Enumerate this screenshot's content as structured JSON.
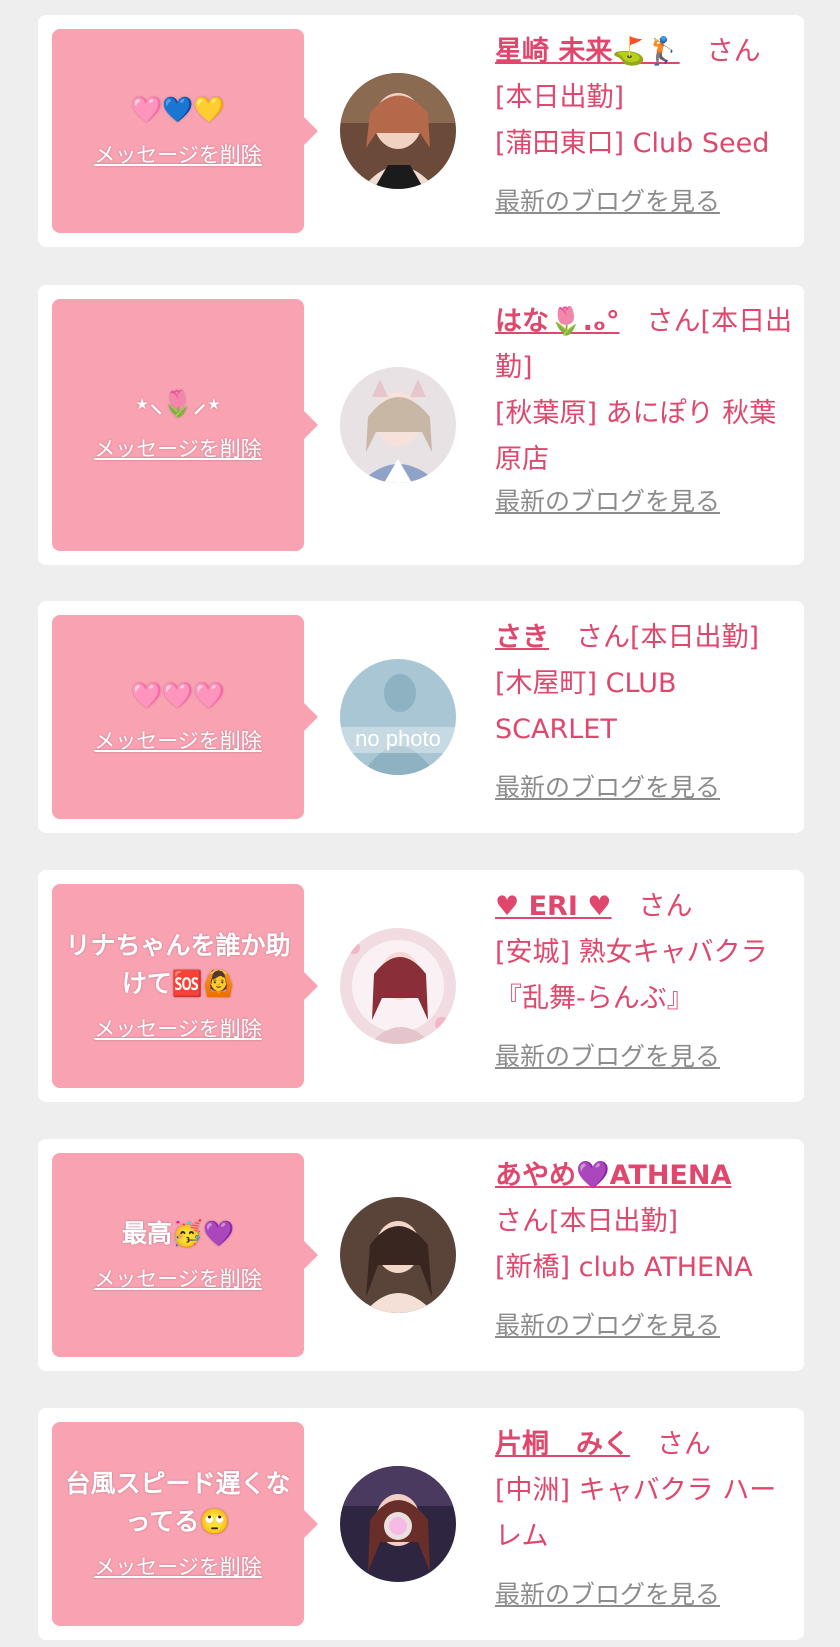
{
  "cards": [
    {
      "message": "🩷💙💛",
      "delete_label": "メッセージを削除",
      "name": "星崎 未来⛳️🏌️",
      "suffix": "　さん",
      "lines": [
        "[本日出勤]",
        "[蒲田東口] Club Seed"
      ],
      "blog_label": "最新のブログを見る",
      "avatar": "photo"
    },
    {
      "message": "⋆⸜🌷⸝⋆",
      "delete_label": "メッセージを削除",
      "name": "はな🌷.ₒ°",
      "suffix": "　さん[本日出勤]",
      "lines": [
        "[秋葉原] あにぽり 秋葉原店"
      ],
      "blog_label": "最新のブログを見る",
      "avatar": "photo"
    },
    {
      "message": "🩷🩷🩷",
      "delete_label": "メッセージを削除",
      "name": "さき",
      "suffix": "　さん[本日出勤]",
      "lines": [
        "[木屋町] CLUB SCARLET"
      ],
      "blog_label": "最新のブログを見る",
      "avatar": "no photo"
    },
    {
      "message": "リナちゃんを誰か助けて🆘🙆",
      "delete_label": "メッセージを削除",
      "name": "♥︎ ERI ♥︎",
      "suffix": "　さん",
      "lines": [
        "[安城] 熟女キャバクラ『乱舞-らんぶ』"
      ],
      "blog_label": "最新のブログを見る",
      "avatar": "photo"
    },
    {
      "message": "最高🥳💜",
      "delete_label": "メッセージを削除",
      "name": "あやめ💜ATHENA",
      "suffix": "さん[本日出勤]",
      "lines": [
        "[新橋] club ATHENA"
      ],
      "blog_label": "最新のブログを見る",
      "avatar": "photo"
    },
    {
      "message": "台風スピード遅くなってる🙄",
      "delete_label": "メッセージを削除",
      "name": "片桐　みく",
      "suffix": "　さん",
      "lines": [
        "[中洲] キャバクラ ハーレム"
      ],
      "blog_label": "最新のブログを見る",
      "avatar": "photo"
    }
  ],
  "colors": {
    "bubble": "#f8a2b2",
    "accent": "#e0476c",
    "link_gray": "#8c8c8c",
    "background": "#eeeeee"
  }
}
